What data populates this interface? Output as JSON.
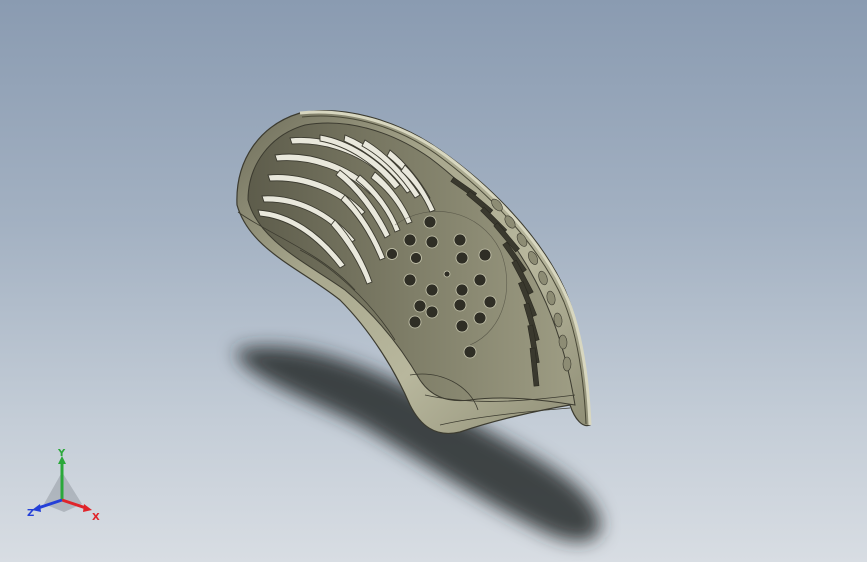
{
  "viewport": {
    "background_top": "#8a9bb1",
    "background_bottom": "#d8dde3",
    "model_color": "#a8a78c"
  },
  "triad": {
    "x_label": "X",
    "y_label": "Y",
    "z_label": "Z",
    "x_color": "#e0242a",
    "y_color": "#2aa83a",
    "z_color": "#2440d8"
  }
}
